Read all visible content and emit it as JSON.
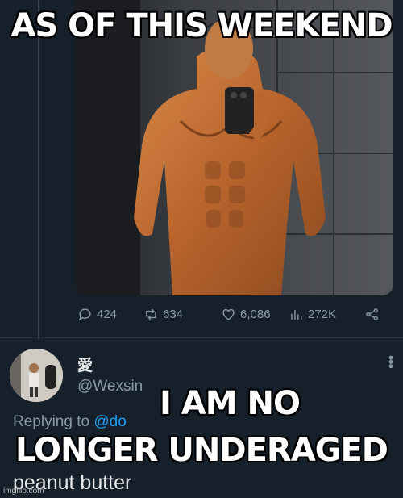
{
  "meme": {
    "top_caption": "AS OF THIS WEEKEND",
    "bottom_caption_line1": "I AM NO",
    "bottom_caption_line2": "LONGER UNDERAGED",
    "watermark": "imgflip.com"
  },
  "tweet_actions": {
    "replies": "424",
    "retweets": "634",
    "likes": "6,086",
    "views": "272K",
    "icons": [
      "reply-icon",
      "retweet-icon",
      "like-icon",
      "views-icon",
      "share-icon"
    ]
  },
  "reply": {
    "display_name": "愛",
    "handle": "@Wexsin",
    "replying_prefix": "Replying to ",
    "replying_mention": "@do",
    "text": "peanut butter"
  },
  "colors": {
    "background": "#15202b",
    "muted": "#8b98a5",
    "accent": "#1d9bf0"
  }
}
